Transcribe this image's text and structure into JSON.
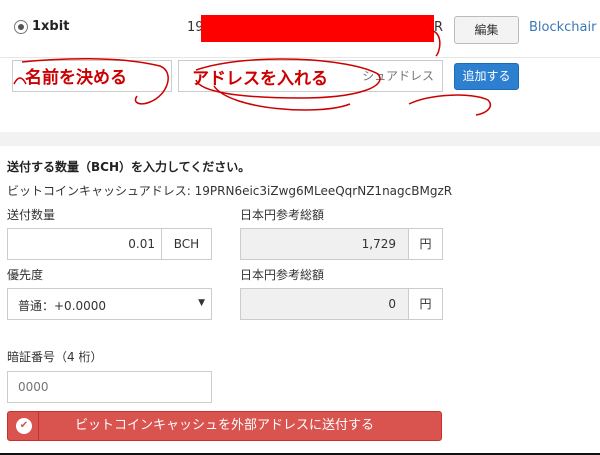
{
  "top": {
    "row": {
      "name": "1xbit",
      "address_prefix": "19",
      "address_suffix": "R",
      "edit_label": "編集",
      "explorer_link": "Blockchair"
    },
    "add": {
      "name_placeholder": "",
      "address_placeholder": "シュアドレス",
      "add_label": "追加する",
      "handwritten_name": "名前を決める",
      "handwritten_address": "アドレスを入れる",
      "annotation_color": "#cc0000"
    }
  },
  "send": {
    "title": "送付する数量（BCH）を入力してください。",
    "address_label": "ビットコインキャッシュアドレス: 19PRN6eic3iZwg6MLeeQqrNZ1nagcBMgzR",
    "amount_label": "送付数量",
    "amount_value": "0.01",
    "amount_unit": "BCH",
    "jpy_label_1": "日本円参考総額",
    "jpy_value_1": "1,729",
    "jpy_unit_1": "円",
    "priority_label": "優先度",
    "priority_value": "普通：+0.0000",
    "jpy_label_2": "日本円参考総額",
    "jpy_value_2": "0",
    "jpy_unit_2": "円",
    "pin_label": "暗証番号（4 桁）",
    "pin_placeholder": "0000",
    "submit_label": "ビットコインキャッシュを外部アドレスに送付する",
    "submit_color": "#d9534f",
    "primary_color": "#2d7fd0"
  }
}
